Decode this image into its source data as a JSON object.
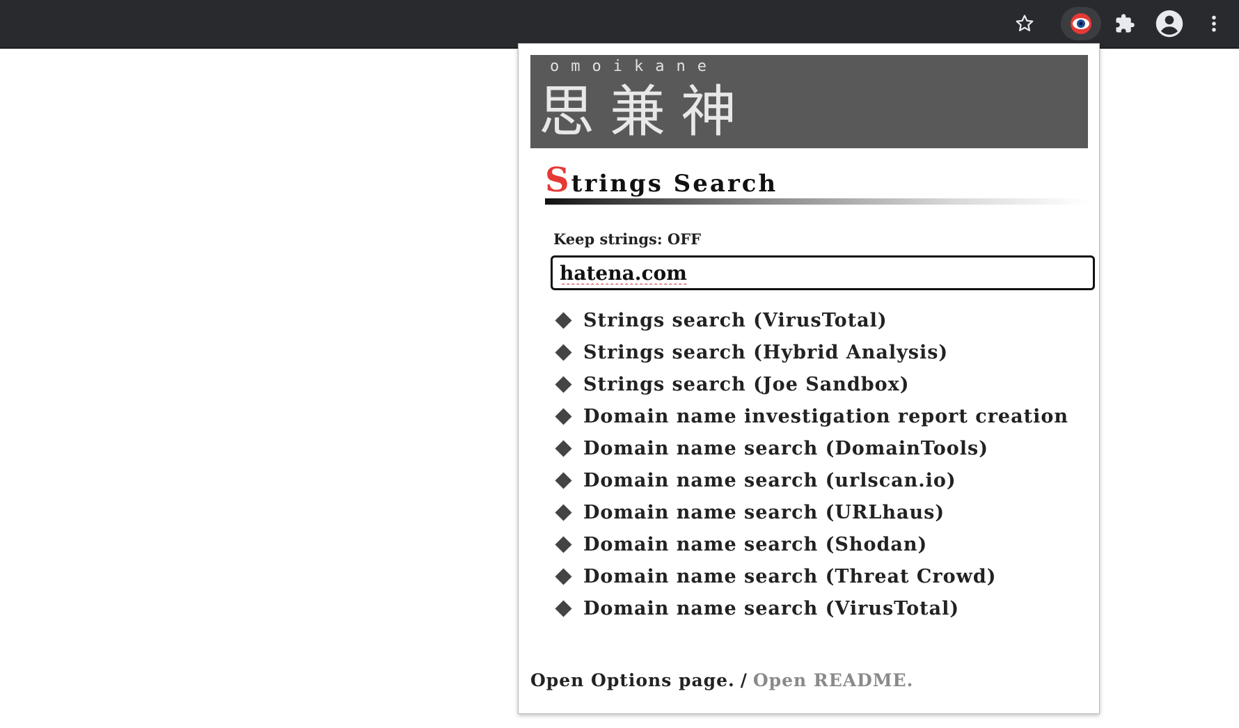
{
  "toolbar": {
    "icons": [
      "star-icon",
      "omoikane-eye-icon",
      "puzzle-icon",
      "account-icon",
      "more-vert-icon"
    ],
    "omoikane_accent": "#e53935"
  },
  "banner": {
    "roman": "omoikane",
    "kanji": "思兼神"
  },
  "section": {
    "title_first": "S",
    "title_rest": "trings Search",
    "accent_color": "#e53935"
  },
  "keep_strings": {
    "label": "Keep strings: OFF"
  },
  "search": {
    "value": "hatena.com"
  },
  "menu": {
    "items": [
      {
        "label": "Strings search (VirusTotal)"
      },
      {
        "label": "Strings search (Hybrid Analysis)"
      },
      {
        "label": "Strings search (Joe Sandbox)"
      },
      {
        "label": "Domain name investigation report creation"
      },
      {
        "label": "Domain name search (DomainTools)"
      },
      {
        "label": "Domain name search (urlscan.io)"
      },
      {
        "label": "Domain name search (URLhaus)"
      },
      {
        "label": "Domain name search (Shodan)"
      },
      {
        "label": "Domain name search (Threat Crowd)"
      },
      {
        "label": "Domain name search (VirusTotal)"
      }
    ]
  },
  "footer": {
    "options_link": "Open Options page.",
    "separator": "/",
    "readme_link": "Open README."
  }
}
